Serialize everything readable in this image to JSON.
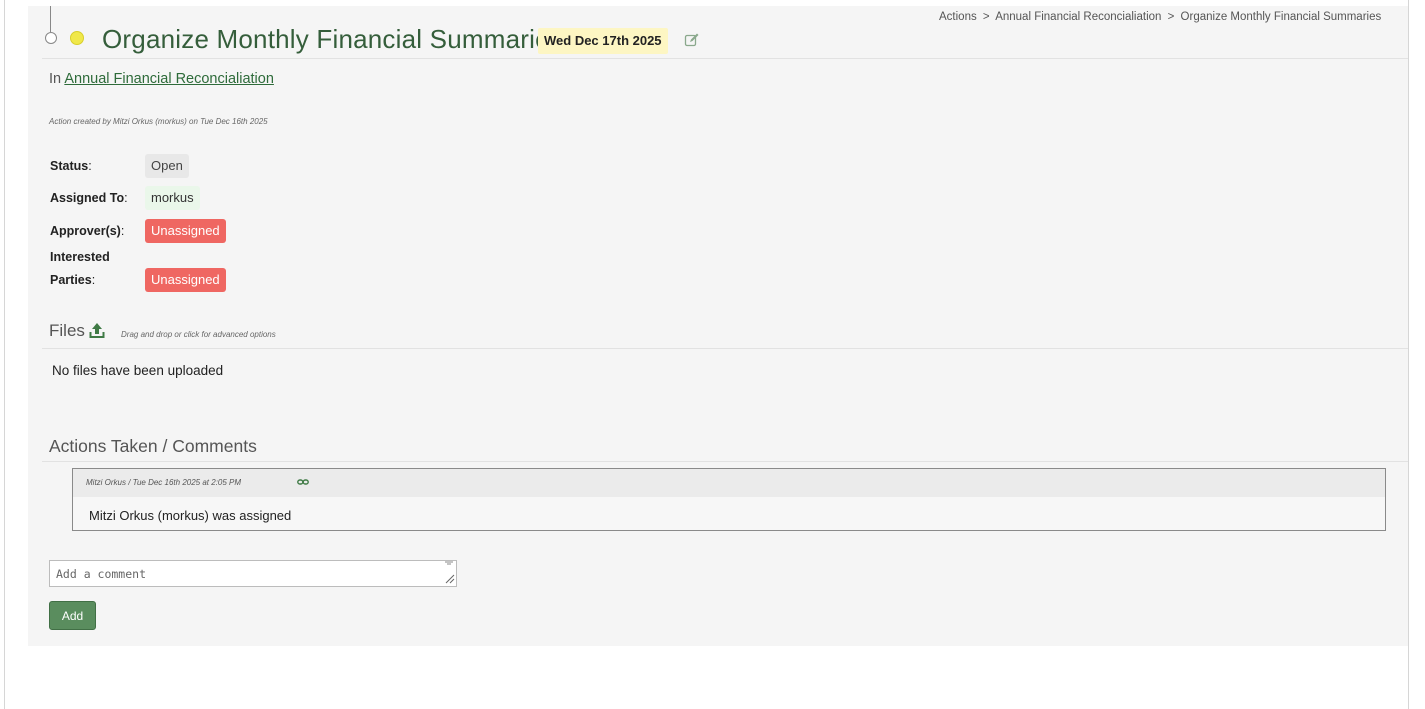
{
  "header": {
    "title": "Organize Monthly Financial Summaries",
    "due_date": "Wed Dec 17th 2025",
    "priority_color": "#f0e84a",
    "edit_icon": "edit-icon"
  },
  "breadcrumb": {
    "items": [
      "Actions",
      "Annual Financial Reconcialiation",
      "Organize Monthly Financial Summaries"
    ],
    "separator": ">"
  },
  "project": {
    "prefix": "In",
    "name": "Annual Financial Reconcialiation"
  },
  "created_note": "Action created by Mitzi Orkus (morkus) on Tue Dec 16th 2025",
  "fields": {
    "status_label": "Status",
    "status_value": "Open",
    "assigned_label": "Assigned To",
    "assigned_value": "morkus",
    "approvers_label": "Approver(s)",
    "approvers_value": "Unassigned",
    "interested_label_line1": "Interested",
    "interested_label_line2": "Parties",
    "interested_value": "Unassigned",
    "colon": ":"
  },
  "files": {
    "title": "Files",
    "upload_icon": "upload-icon",
    "hint": "Drag and drop or click for advanced options",
    "empty_message": "No files have been uploaded"
  },
  "comments": {
    "title": "Actions Taken / Comments",
    "items": [
      {
        "meta": "Mitzi Orkus / Tue Dec 16th 2025 at 2:05 PM",
        "body": "Mitzi Orkus (morkus) was assigned"
      }
    ],
    "input_placeholder": "Add a comment",
    "add_label": "Add"
  },
  "colors": {
    "accent_green": "#5a8d5e",
    "title_green": "#355e3b",
    "unassigned_red": "#ef6762",
    "due_badge": "#fdf6c3"
  }
}
